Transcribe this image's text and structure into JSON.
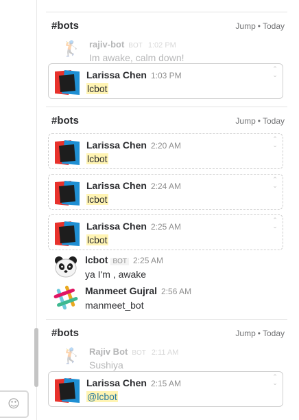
{
  "composer": {
    "emoji_icon": "☺"
  },
  "sections": [
    {
      "channel": "#bots",
      "jump": "Jump",
      "dot": "•",
      "today": "Today"
    },
    {
      "channel": "#bots",
      "jump": "Jump",
      "dot": "•",
      "today": "Today"
    },
    {
      "channel": "#bots",
      "jump": "Jump",
      "dot": "•",
      "today": "Today"
    }
  ],
  "ghosts": [
    {
      "name": "rajiv-bot",
      "bot": "BOT",
      "time": "1:02 PM",
      "text": "Im awake, calm down!"
    },
    {
      "name": "Rajiv Bot",
      "bot": "BOT",
      "time": "2:11 AM",
      "text": "Sushiya"
    }
  ],
  "cards": [
    {
      "name": "Larissa Chen",
      "time": "1:03 PM",
      "text": "lcbot"
    },
    {
      "name": "Larissa Chen",
      "time": "2:20 AM",
      "text": "lcbot"
    },
    {
      "name": "Larissa Chen",
      "time": "2:24 AM",
      "text": "lcbot"
    },
    {
      "name": "Larissa Chen",
      "time": "2:25 AM",
      "text": "lcbot"
    },
    {
      "name": "Larissa Chen",
      "time": "2:15 AM",
      "text": "@lcbot"
    }
  ],
  "messages": [
    {
      "name": "lcbot",
      "bot": "BOT",
      "time": "2:25 AM",
      "text": "ya I'm , awake"
    },
    {
      "name": "Manmeet Gujral",
      "time": "2:56 AM",
      "text": "manmeet_bot"
    }
  ],
  "card_arrows": {
    "up": "⌃",
    "down": "⌄"
  },
  "colors": {
    "highlight": "#fff4b3",
    "mention": "#2a7a9e",
    "avatar_red": "#e8322c",
    "avatar_blue": "#1f8fd3"
  }
}
